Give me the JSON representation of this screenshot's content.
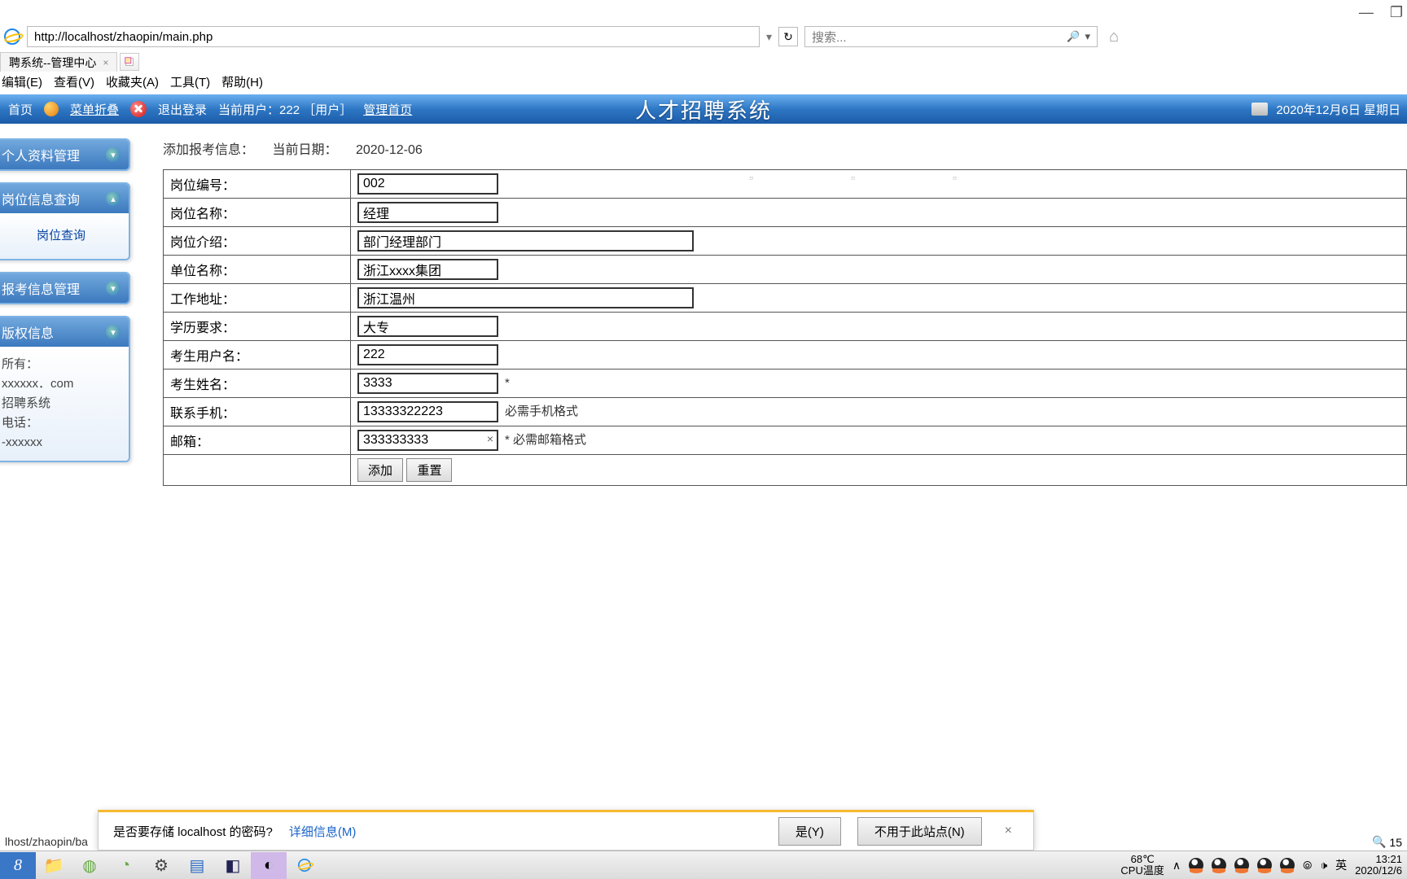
{
  "window": {
    "minimize": "—",
    "maximize": "❐"
  },
  "addr": {
    "url": "http://localhost/zhaopin/main.php",
    "dropdown": "▾",
    "refresh": "↻"
  },
  "search": {
    "placeholder": "搜索...",
    "mag": "🔎",
    "drop": "▾"
  },
  "tab": {
    "title": "聘系统--管理中心",
    "newtab_tip": "新建"
  },
  "menu": {
    "edit": "编辑(E)",
    "view": "查看(V)",
    "fav": "收藏夹(A)",
    "tools": "工具(T)",
    "help": "帮助(H)"
  },
  "banner": {
    "home": "首页",
    "fold": "菜单折叠",
    "logout": "退出登录",
    "curuser": "当前用户：222 ［用户］",
    "adminhome": "管理首页",
    "systitle": "人才招聘系统",
    "date": "2020年12月6日 星期日"
  },
  "sidebar": {
    "p1": "个人资料管理",
    "p2": "岗位信息查询",
    "p2_link": "岗位查询",
    "p3": "报考信息管理",
    "p4": "版权信息",
    "copy1": "所有：",
    "copy2": "xxxxxx．com",
    "copy3": "招聘系统",
    "copy4": "电话：",
    "copy5": "-xxxxxx"
  },
  "page": {
    "heading": "添加报考信息：",
    "curdate_label": "当前日期：",
    "curdate": "2020-12-06",
    "rows": [
      {
        "label": "岗位编号：",
        "value": "002",
        "w": "s"
      },
      {
        "label": "岗位名称：",
        "value": "经理",
        "w": "s"
      },
      {
        "label": "岗位介绍：",
        "value": "部门经理部门",
        "w": "l"
      },
      {
        "label": "单位名称：",
        "value": "浙江xxxx集团",
        "w": "s"
      },
      {
        "label": "工作地址：",
        "value": "浙江温州",
        "w": "l"
      },
      {
        "label": "学历要求：",
        "value": "大专",
        "w": "s"
      },
      {
        "label": "考生用户名：",
        "value": "222",
        "w": "s"
      },
      {
        "label": "考生姓名：",
        "value": "3333",
        "w": "s",
        "hint": "*"
      },
      {
        "label": "联系手机：",
        "value": "13333322223",
        "w": "s",
        "hint": "必需手机格式"
      },
      {
        "label": "邮箱：",
        "value": "333333333",
        "w": "s",
        "hint": "* 必需邮箱格式",
        "clear": true
      }
    ],
    "submit": "添加",
    "reset": "重置"
  },
  "pwbar": {
    "msg": "是否要存储 localhost 的密码?",
    "more": "详细信息(M)",
    "yes": "是(Y)",
    "no": "不用于此站点(N)",
    "close": "×"
  },
  "status": {
    "text": "lhost/zhaopin/ba",
    "zoom": "15"
  },
  "taskbar": {
    "temp_c": "68℃",
    "temp_l": "CPU温度",
    "ime_up": "∧",
    "wifi": "⦾",
    "sound": "🕩",
    "lang": "英",
    "time": "13:21",
    "date": "2020/12/6"
  }
}
